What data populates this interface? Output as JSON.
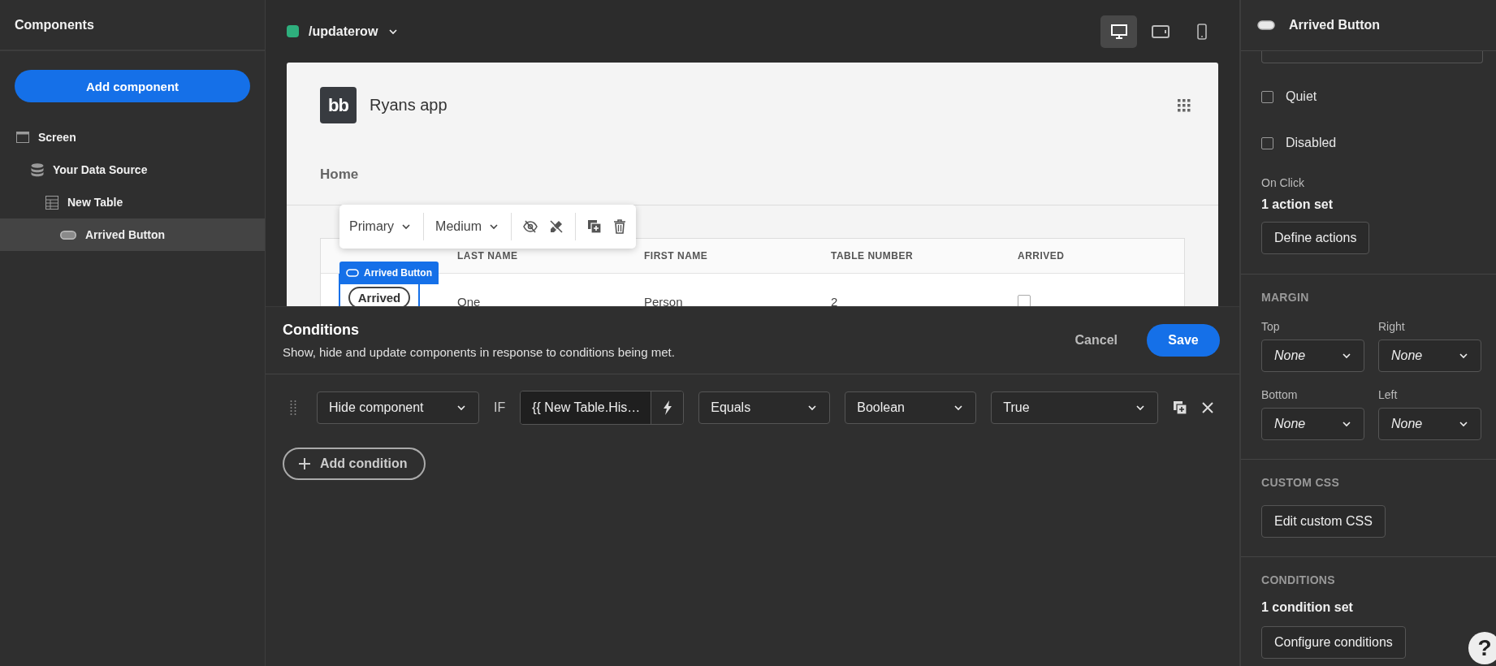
{
  "sidebar": {
    "title": "Components",
    "add_button": "Add component",
    "tree": [
      {
        "label": "Screen",
        "kind": "screen",
        "selected": false,
        "children": [
          {
            "label": "Your Data Source",
            "kind": "datasource",
            "selected": false,
            "children": [
              {
                "label": "New Table",
                "kind": "table",
                "selected": false,
                "children": [
                  {
                    "label": "Arrived Button",
                    "kind": "button",
                    "selected": true
                  }
                ]
              }
            ]
          }
        ]
      }
    ]
  },
  "topbar": {
    "route": "/updaterow",
    "devices": [
      {
        "kind": "desktop",
        "selected": true
      },
      {
        "kind": "tablet",
        "selected": false
      },
      {
        "kind": "mobile",
        "selected": false
      }
    ]
  },
  "preview": {
    "logo_text": "bb",
    "app_name": "Ryans app",
    "nav": [
      "Home"
    ],
    "toolbar": {
      "selects": [
        "Primary",
        "Medium"
      ]
    },
    "component_tag": "Arrived Button",
    "table": {
      "columns": [
        "LAST NAME",
        "FIRST NAME",
        "TABLE NUMBER",
        "ARRIVED"
      ],
      "rows": [
        {
          "button": "Arrived",
          "last_name": "One",
          "first_name": "Person",
          "table_number": "2",
          "arrived": false
        }
      ]
    }
  },
  "conditions_panel": {
    "title": "Conditions",
    "subtitle": "Show, hide and update components in response to conditions being met.",
    "cancel": "Cancel",
    "save": "Save",
    "conditions": [
      {
        "action": "Hide component",
        "if": "IF",
        "binding": "{{ New Table.His…",
        "operator": "Equals",
        "type": "Boolean",
        "value": "True"
      }
    ],
    "add_button": "Add condition"
  },
  "settings": {
    "title": "Arrived Button",
    "checkboxes": [
      {
        "label": "Quiet",
        "checked": false
      },
      {
        "label": "Disabled",
        "checked": false
      }
    ],
    "on_click": {
      "label": "On Click",
      "summary": "1 action set",
      "button": "Define actions"
    },
    "margin": {
      "heading": "MARGIN",
      "fields": [
        {
          "label": "Top",
          "value": "None"
        },
        {
          "label": "Right",
          "value": "None"
        },
        {
          "label": "Bottom",
          "value": "None"
        },
        {
          "label": "Left",
          "value": "None"
        }
      ]
    },
    "custom_css": {
      "heading": "CUSTOM CSS",
      "button": "Edit custom CSS"
    },
    "conditions": {
      "heading": "CONDITIONS",
      "summary": "1 condition set",
      "button": "Configure conditions"
    },
    "help": "?"
  }
}
